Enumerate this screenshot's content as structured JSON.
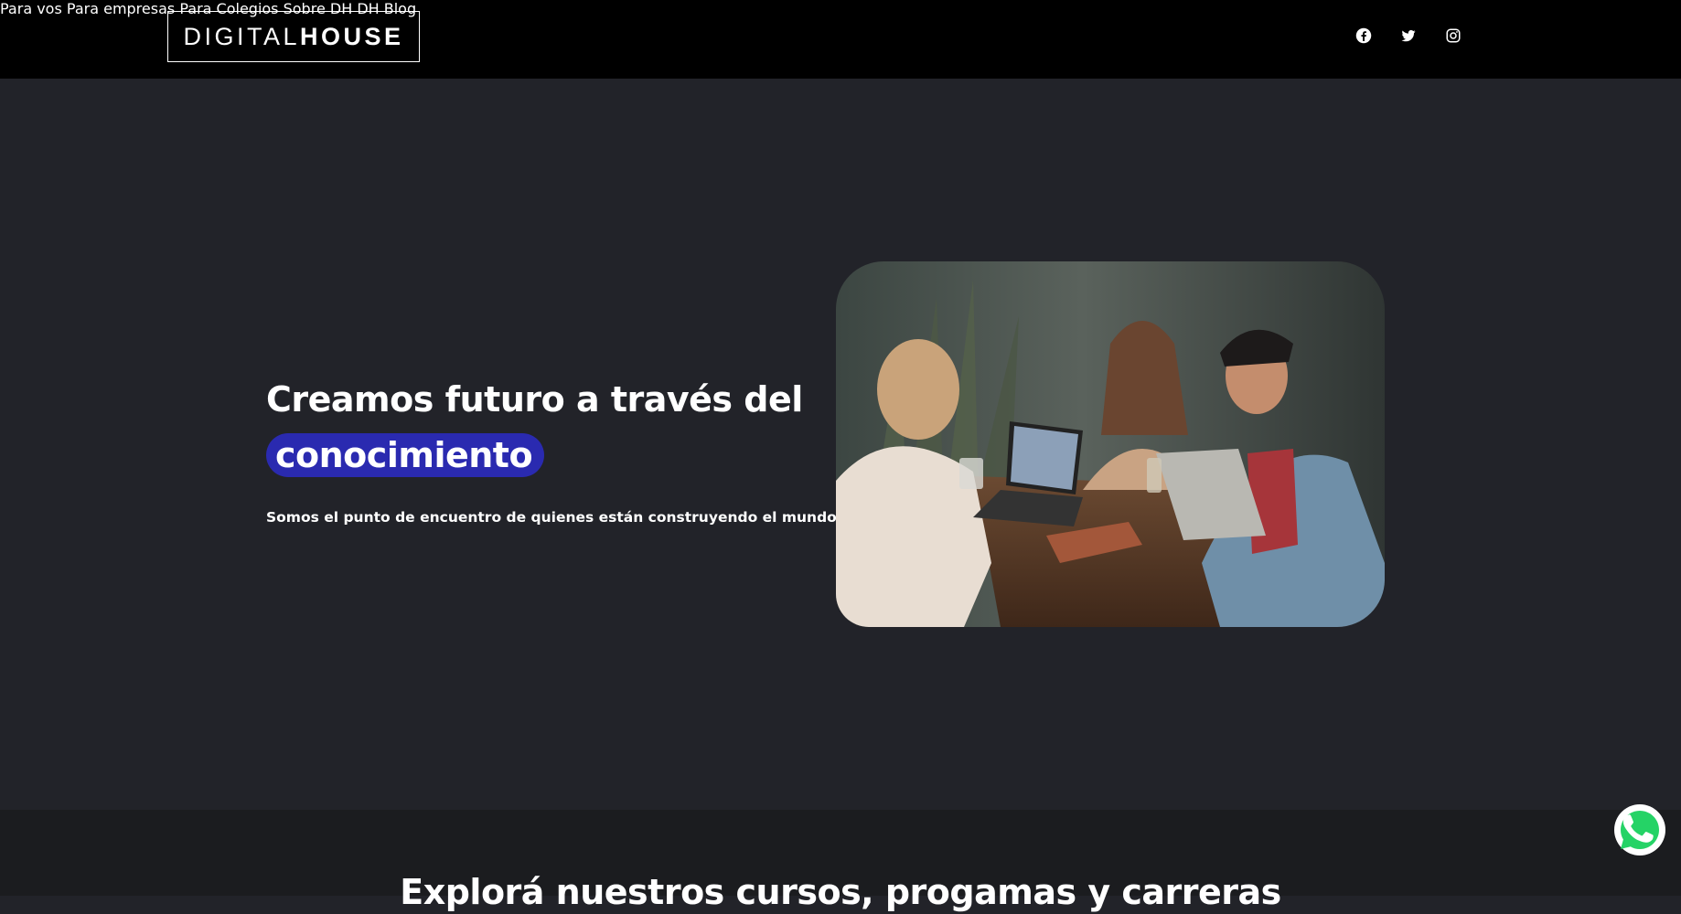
{
  "header": {
    "logo": {
      "light": "DIGITAL",
      "bold": "HOUSE"
    },
    "nav": [
      {
        "label": "Para vos"
      },
      {
        "label": "Para empresas"
      },
      {
        "label": "Para Colegios"
      },
      {
        "label": "Sobre DH"
      },
      {
        "label": "DH Blog"
      }
    ],
    "social": [
      "facebook-icon",
      "twitter-icon",
      "instagram-icon"
    ]
  },
  "hero": {
    "title_line1": "Creamos futuro a través del",
    "title_highlight": "conocimiento",
    "subtitle": "Somos el punto de encuentro de quienes están construyendo el mundo digital.",
    "highlight_color": "#2a2ab0"
  },
  "explore": {
    "title": "Explorá nuestros cursos, progamas y carreras"
  },
  "colors": {
    "background": "#222329",
    "header": "#000000",
    "accent": "#2a2ab0",
    "whatsapp": "#25d366"
  }
}
